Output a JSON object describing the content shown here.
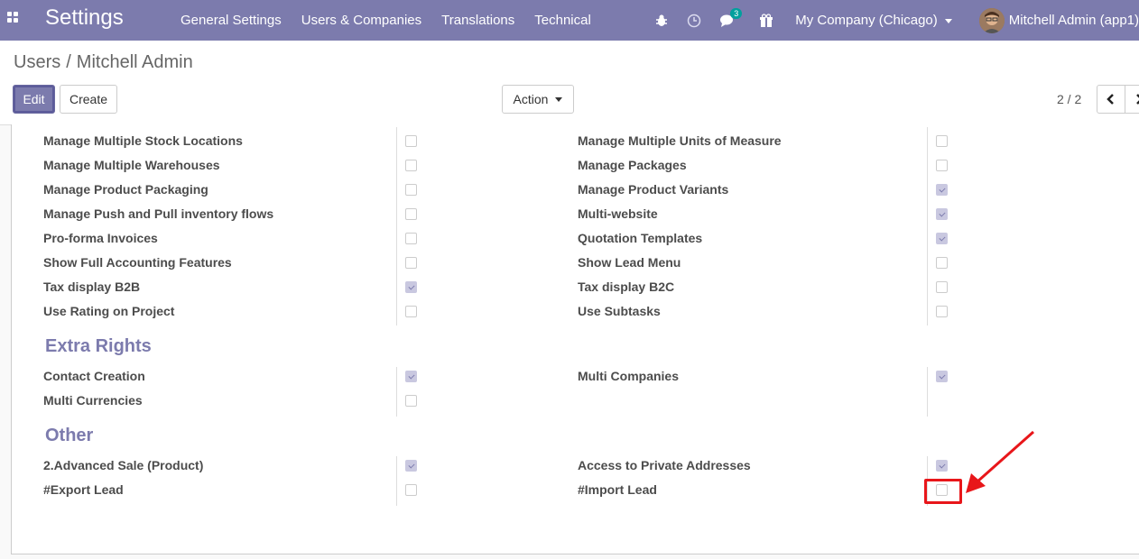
{
  "navbar": {
    "brand": "Settings",
    "menu": [
      "General Settings",
      "Users & Companies",
      "Translations",
      "Technical"
    ],
    "messages_badge": "3",
    "company": "My Company (Chicago)",
    "user": "Mitchell Admin (app1)"
  },
  "breadcrumb": {
    "parent": "Users",
    "separator": "/",
    "current": "Mitchell Admin"
  },
  "buttons": {
    "edit": "Edit",
    "create": "Create",
    "action": "Action"
  },
  "pager": {
    "value": "2 / 2"
  },
  "technical_rows": {
    "left": [
      {
        "label": "Manage Multiple Stock Locations",
        "checked": false
      },
      {
        "label": "Manage Multiple Warehouses",
        "checked": false
      },
      {
        "label": "Manage Product Packaging",
        "checked": false
      },
      {
        "label": "Manage Push and Pull inventory flows",
        "checked": false
      },
      {
        "label": "Pro-forma Invoices",
        "checked": false
      },
      {
        "label": "Show Full Accounting Features",
        "checked": false
      },
      {
        "label": "Tax display B2B",
        "checked": true
      },
      {
        "label": "Use Rating on Project",
        "checked": false
      }
    ],
    "right": [
      {
        "label": "Manage Multiple Units of Measure",
        "checked": false
      },
      {
        "label": "Manage Packages",
        "checked": false
      },
      {
        "label": "Manage Product Variants",
        "checked": true
      },
      {
        "label": "Multi-website",
        "checked": true
      },
      {
        "label": "Quotation Templates",
        "checked": true
      },
      {
        "label": "Show Lead Menu",
        "checked": false
      },
      {
        "label": "Tax display B2C",
        "checked": false
      },
      {
        "label": "Use Subtasks",
        "checked": false
      }
    ]
  },
  "extra_rights": {
    "title": "Extra Rights",
    "left": [
      {
        "label": "Contact Creation",
        "checked": true
      },
      {
        "label": "Multi Currencies",
        "checked": false
      }
    ],
    "right": [
      {
        "label": "Multi Companies",
        "checked": true
      }
    ]
  },
  "other": {
    "title": "Other",
    "left": [
      {
        "label": "2.Advanced Sale (Product)",
        "checked": true
      },
      {
        "label": "#Export Lead",
        "checked": false
      }
    ],
    "right": [
      {
        "label": "Access to Private Addresses",
        "checked": true
      },
      {
        "label": "#Import Lead",
        "checked": false
      }
    ]
  },
  "colors": {
    "brand": "#7c7bad",
    "annotation": "#e8161a"
  }
}
